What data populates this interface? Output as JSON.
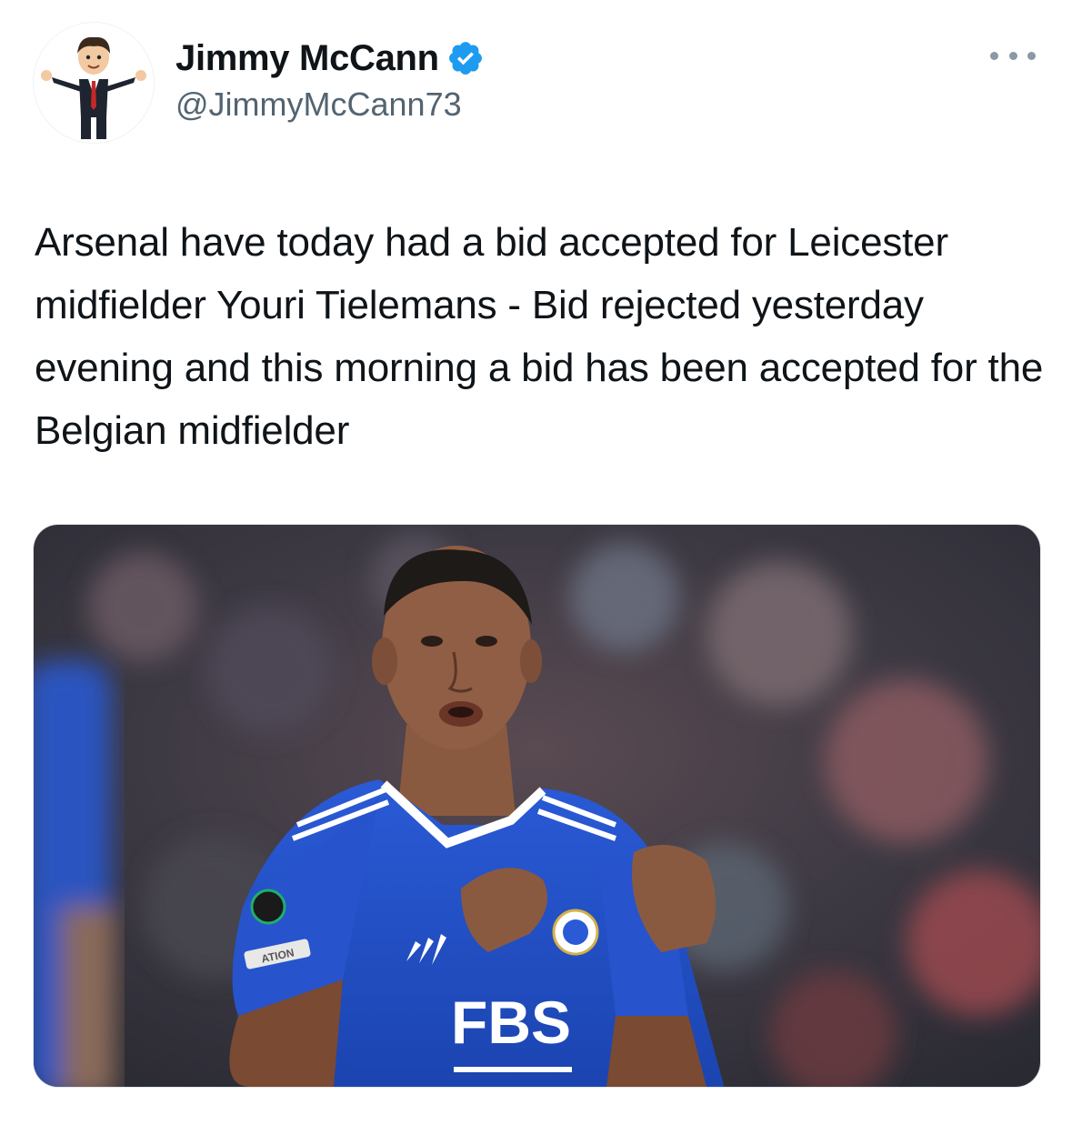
{
  "tweet": {
    "author": {
      "display_name": "Jimmy McCann",
      "handle": "@JimmyMcCann73",
      "verified": true,
      "avatar_icon": "cartoon-businessman-avatar"
    },
    "text": "Arsenal have today had a bid accepted for Leicester midfielder Youri Tielemans - Bid rejected yesterday evening and this morning a bid has been accepted for the Belgian midfielder",
    "more_icon": "more-options-icon",
    "media": {
      "jersey_sponsor": "FBS",
      "sleeve_patch_text": "ATION",
      "jersey_color": "#1f4fc4",
      "description_icon": "photo-icon"
    }
  },
  "colors": {
    "verified_blue": "#1d9bf0",
    "secondary_text": "#536471",
    "primary_text": "#0f1419"
  }
}
